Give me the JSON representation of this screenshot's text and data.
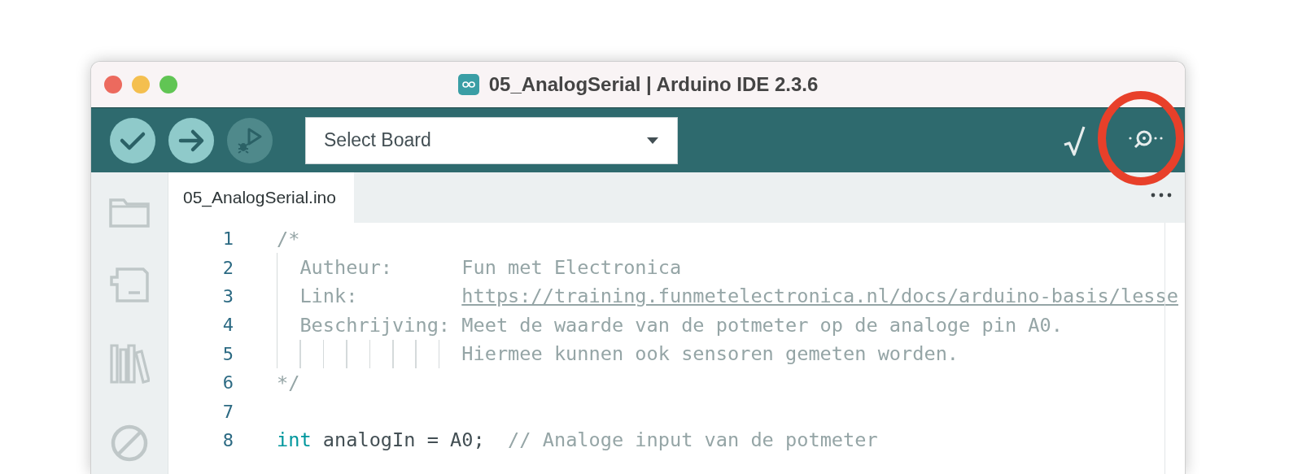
{
  "window": {
    "title": "05_AnalogSerial | Arduino IDE 2.3.6"
  },
  "toolbar": {
    "buttons": [
      {
        "disabled": false
      },
      {
        "disabled": false
      },
      {
        "disabled": true
      }
    ],
    "board_selector": {
      "value": "Select Board"
    }
  },
  "tabs": [
    {
      "label": "05_AnalogSerial.ino",
      "selected": true
    }
  ],
  "editor": {
    "lines": [
      {
        "number": "1",
        "tokens": [
          {
            "kind": "comment",
            "text": "/*"
          }
        ]
      },
      {
        "number": "2",
        "tokens": [
          {
            "kind": "comment",
            "text": "  Autheur:      Fun met Electronica"
          }
        ]
      },
      {
        "number": "3",
        "tokens": [
          {
            "kind": "comment",
            "text": "  Link:         "
          },
          {
            "kind": "link",
            "text": "https://training.funmetelectronica.nl/docs/arduino-basis/lesse"
          }
        ]
      },
      {
        "number": "4",
        "tokens": [
          {
            "kind": "comment",
            "text": "  Beschrijving: Meet de waarde van de potmeter op de analoge pin A0."
          }
        ]
      },
      {
        "number": "5",
        "tokens": [
          {
            "kind": "comment",
            "text": "                Hiermee kunnen ook sensoren gemeten worden."
          }
        ]
      },
      {
        "number": "6",
        "tokens": [
          {
            "kind": "comment",
            "text": "*/"
          }
        ]
      },
      {
        "number": "7"
      },
      {
        "number": "8",
        "tokens": [
          {
            "kind": "keyword",
            "text": "int"
          },
          {
            "kind": "plain",
            "text": " analogIn = A0;"
          },
          {
            "kind": "comment",
            "text": "  // Analoge input van de potmeter"
          }
        ]
      }
    ]
  }
}
